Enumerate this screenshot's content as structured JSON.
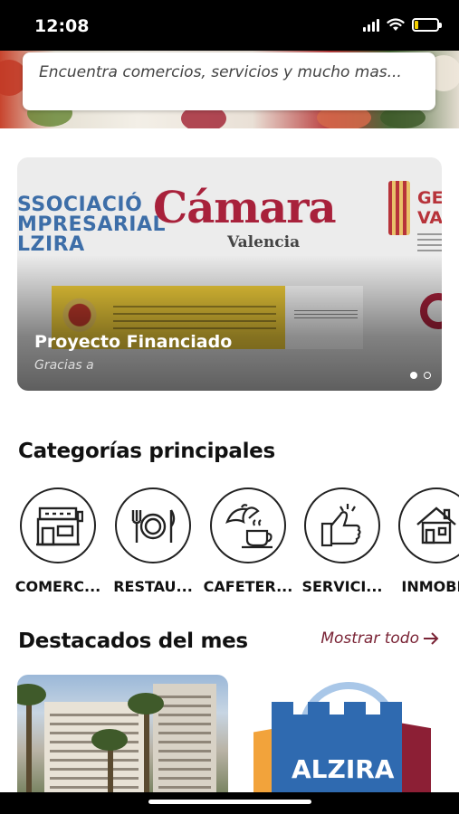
{
  "status_bar": {
    "time": "12:08",
    "icons": [
      "signal-icon",
      "wifi-icon",
      "battery-icon"
    ],
    "battery_color": "#f5d000"
  },
  "search": {
    "placeholder": "Encuentra comercios, servicios y mucho mas..."
  },
  "banner": {
    "logo_associacio": "SSOCIACIÓ\nMPRESARIAL\nLZIRA",
    "logo_camara": "Cámara",
    "logo_camara_sub": "Valencia",
    "logo_generalitat": "GE\nVA",
    "title": "Proyecto Financiado",
    "subtitle": "Gracias a",
    "slides": 2,
    "active_slide": 1
  },
  "categories": {
    "title": "Categorías principales",
    "items": [
      {
        "label": "COMERC...",
        "icon": "storefront-icon"
      },
      {
        "label": "RESTAU...",
        "icon": "plate-cutlery-icon"
      },
      {
        "label": "CAFETER...",
        "icon": "coffee-croissant-icon"
      },
      {
        "label": "SERVICI...",
        "icon": "thumbs-up-icon"
      },
      {
        "label": "INMOBIL",
        "icon": "house-icon"
      }
    ]
  },
  "featured": {
    "title": "Destacados del mes",
    "show_all": "Mostrar todo",
    "cards": [
      {
        "image": "city-buildings-palms"
      },
      {
        "image": "shopping-bag-logo",
        "text": "ALZIRA"
      }
    ]
  },
  "colors": {
    "accent": "#7a2436",
    "brand_red": "#a8213b"
  }
}
